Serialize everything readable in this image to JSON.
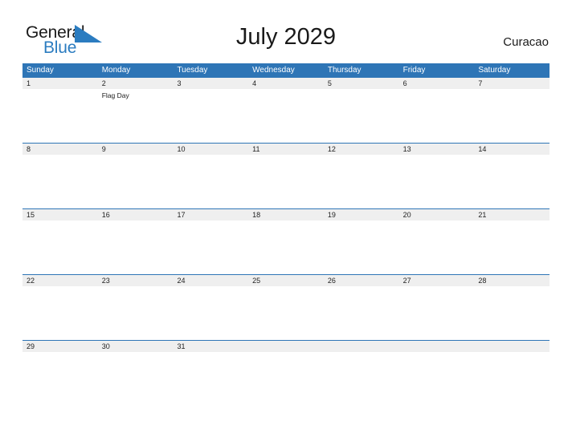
{
  "brand": {
    "name_part1": "General",
    "name_part2": "Blue",
    "triangle_color": "#2b7cc0"
  },
  "header": {
    "title": "July 2029",
    "region": "Curacao"
  },
  "colors": {
    "header_blue": "#2e75b6",
    "date_strip_gray": "#efefef",
    "row_divider_blue": "#2e75b6",
    "text_dark": "#1a1a1a"
  },
  "calendar": {
    "month": "July",
    "year": "2029",
    "weekdays": [
      "Sunday",
      "Monday",
      "Tuesday",
      "Wednesday",
      "Thursday",
      "Friday",
      "Saturday"
    ],
    "weeks": [
      {
        "days": [
          {
            "date": "1",
            "events": []
          },
          {
            "date": "2",
            "events": [
              "Flag Day"
            ]
          },
          {
            "date": "3",
            "events": []
          },
          {
            "date": "4",
            "events": []
          },
          {
            "date": "5",
            "events": []
          },
          {
            "date": "6",
            "events": []
          },
          {
            "date": "7",
            "events": []
          }
        ]
      },
      {
        "days": [
          {
            "date": "8",
            "events": []
          },
          {
            "date": "9",
            "events": []
          },
          {
            "date": "10",
            "events": []
          },
          {
            "date": "11",
            "events": []
          },
          {
            "date": "12",
            "events": []
          },
          {
            "date": "13",
            "events": []
          },
          {
            "date": "14",
            "events": []
          }
        ]
      },
      {
        "days": [
          {
            "date": "15",
            "events": []
          },
          {
            "date": "16",
            "events": []
          },
          {
            "date": "17",
            "events": []
          },
          {
            "date": "18",
            "events": []
          },
          {
            "date": "19",
            "events": []
          },
          {
            "date": "20",
            "events": []
          },
          {
            "date": "21",
            "events": []
          }
        ]
      },
      {
        "days": [
          {
            "date": "22",
            "events": []
          },
          {
            "date": "23",
            "events": []
          },
          {
            "date": "24",
            "events": []
          },
          {
            "date": "25",
            "events": []
          },
          {
            "date": "26",
            "events": []
          },
          {
            "date": "27",
            "events": []
          },
          {
            "date": "28",
            "events": []
          }
        ]
      },
      {
        "days": [
          {
            "date": "29",
            "events": []
          },
          {
            "date": "30",
            "events": []
          },
          {
            "date": "31",
            "events": []
          },
          {
            "date": "",
            "events": []
          },
          {
            "date": "",
            "events": []
          },
          {
            "date": "",
            "events": []
          },
          {
            "date": "",
            "events": []
          }
        ]
      }
    ]
  }
}
